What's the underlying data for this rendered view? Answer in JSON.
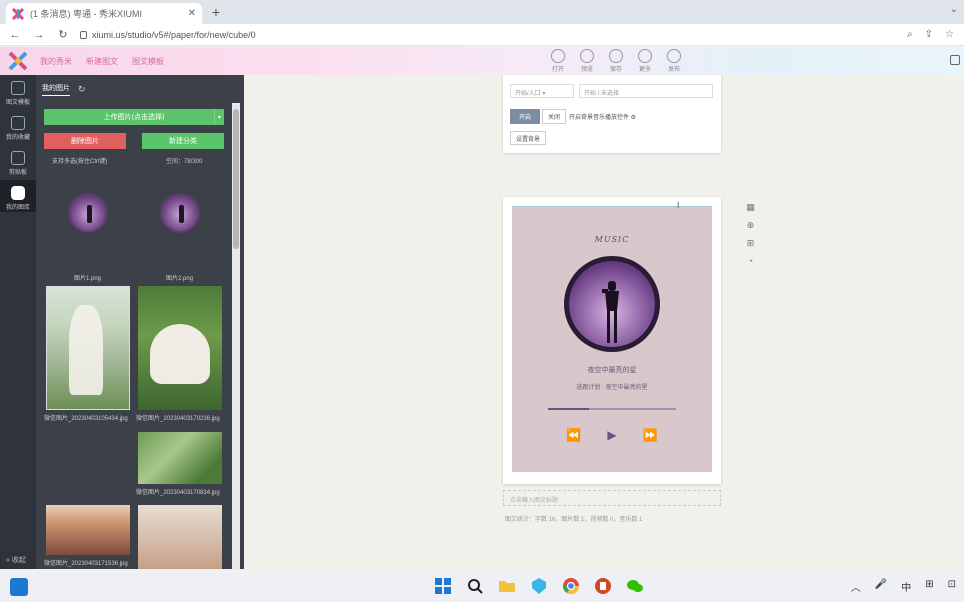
{
  "browser": {
    "tab_title": "(1 条消息) 粤通 - 秀米XIUMI",
    "tab_close": "✕",
    "new_tab": "+",
    "window_chevron": "⌄",
    "url": "xiumi.us/studio/v5#/paper/for/new/cube/0",
    "back": "←",
    "forward": "→",
    "reload": "↻",
    "right_icons": [
      "⌕",
      "⇪",
      "☆"
    ]
  },
  "app": {
    "header_links": [
      "我的秀米",
      "新建图文",
      "图文模板"
    ],
    "tools": [
      "打开",
      "预览",
      "保存",
      "更多",
      "发布"
    ]
  },
  "rail": {
    "items": [
      "图文模板",
      "我的收藏",
      "剪贴板",
      "我的图库"
    ],
    "collapse": "« 收起"
  },
  "panel": {
    "tab": "我的图片",
    "refresh": "↻",
    "upload_label": "上传图片(点击选择)",
    "upload_caret": "▾",
    "delete_label": "删除图片",
    "new_folder_label": "新建分类",
    "hint": "支持多选(按住Ctrl键)",
    "capacity": "空间：78/300",
    "files": [
      {
        "name": "图片1.png"
      },
      {
        "name": "图片2.png"
      },
      {
        "name": "微信图片_20230403105434.jpg"
      },
      {
        "name": "微信图片_20230403170236.jpg"
      },
      {
        "name": "微信图片_20230403170834.jpg"
      },
      {
        "name": "微信图片_20230403171536.jpg"
      }
    ]
  },
  "settings": {
    "input1": "开始/入口 ▾",
    "input2": "开始 / 未选择",
    "btn_primary": "开启",
    "btn_secondary": "关闭",
    "option": "开启背景音乐播放控件 ⚙",
    "btn_save": "设置背景"
  },
  "canvas": {
    "music_title": "MUSIC",
    "song": "夜空中最亮的星",
    "artist": "逃跑计划 · 夜空中最亮的星",
    "progress_fraction": 0.32,
    "controls": [
      "⏪",
      "▶",
      "⏩"
    ],
    "page_name_placeholder": "点击输入图文标题",
    "stats": "图文统计：字数 16，图片数 1，视频数 0，音乐数 1"
  },
  "side_tools": [
    "▦",
    "⊕",
    "⊞",
    "◔"
  ],
  "taskbar": {
    "right": [
      "︿",
      "🎤",
      "中",
      "⊞",
      "⊡"
    ]
  },
  "colors": {
    "accent_green": "#5cc46a",
    "danger_red": "#e06060",
    "panel_dark": "#3c4049",
    "music_purple": "#6d4f86"
  }
}
